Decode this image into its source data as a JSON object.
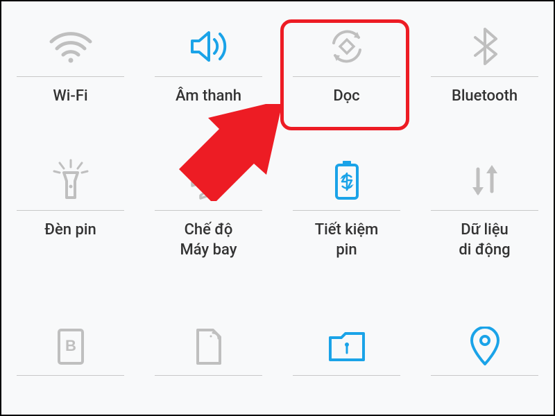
{
  "colors": {
    "active": "#1aa3e8",
    "inactive": "#bfbfbf",
    "highlight": "#ed1c24"
  },
  "tiles": [
    {
      "id": "wifi",
      "label": "Wi-Fi",
      "icon": "wifi-icon",
      "active": false
    },
    {
      "id": "sound",
      "label": "Âm thanh",
      "icon": "speaker-icon",
      "active": true
    },
    {
      "id": "rotation",
      "label": "Dọc",
      "icon": "auto-rotate-icon",
      "active": false,
      "highlighted": true
    },
    {
      "id": "bluetooth",
      "label": "Bluetooth",
      "icon": "bluetooth-icon",
      "active": false
    },
    {
      "id": "flashlight",
      "label": "Đèn pin",
      "icon": "flashlight-icon",
      "active": false
    },
    {
      "id": "airplane",
      "label": "Chế độ\nMáy bay",
      "icon": "airplane-icon",
      "active": false
    },
    {
      "id": "battery-saver",
      "label": "Tiết kiệm\npin",
      "icon": "battery-saver-icon",
      "active": true
    },
    {
      "id": "mobile-data",
      "label": "Dữ liệu\ndi động",
      "icon": "mobile-data-icon",
      "active": false
    },
    {
      "id": "blue-light",
      "label": "",
      "icon": "blue-light-icon",
      "active": false
    },
    {
      "id": "sim",
      "label": "",
      "icon": "sim-icon",
      "active": false
    },
    {
      "id": "secure-folder",
      "label": "",
      "icon": "secure-folder-icon",
      "active": true
    },
    {
      "id": "location",
      "label": "",
      "icon": "location-icon",
      "active": true
    }
  ]
}
